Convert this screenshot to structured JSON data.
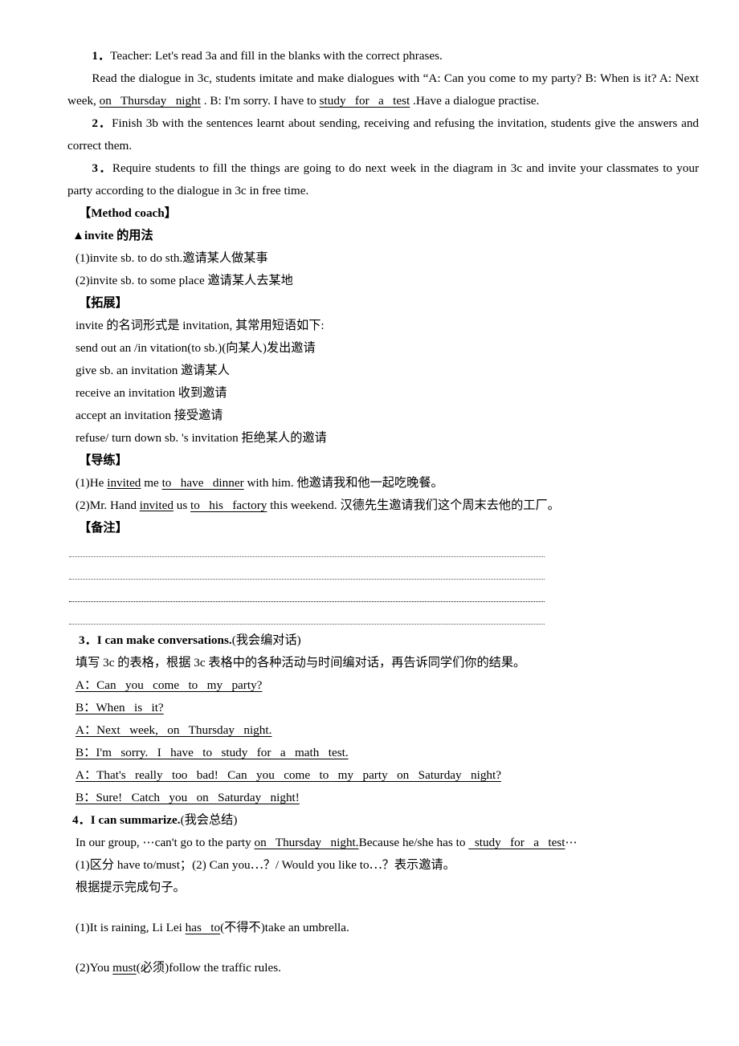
{
  "document": {
    "type": "lesson-plan-worksheet",
    "language": "en-zh"
  },
  "steps": [
    {
      "num": "1．",
      "text": "Teacher:  Let's read 3a and fill in the blanks with the correct phrases."
    },
    {
      "num": "",
      "text_pre": "Read the dialogue in 3c, students imitate and make dialogues with “A:  Can you come to my party? B: When is it? A: Next week, ",
      "blank1": "on   Thursday   night",
      "text_mid": " . B: I'm sorry. I have to ",
      "blank2": "study   for   a   test",
      "text_post": " .Have a dialogue practise."
    },
    {
      "num": "2．",
      "text": "Finish 3b with the sentences learnt about sending, receiving and refusing the invitation, students give the answers and correct them."
    },
    {
      "num": "3．",
      "text": "Require students to fill the things are going to do next week in the diagram in 3c and invite your classmates to your party according to the dialogue in 3c in free time."
    }
  ],
  "method_coach": {
    "heading": "【Method coach】",
    "subheading": "▲invite 的用法",
    "usages": [
      "(1)invite sb. to do sth.邀请某人做某事",
      "(2)invite sb. to some place 邀请某人去某地"
    ]
  },
  "expansion": {
    "heading": "【拓展】",
    "intro": "invite 的名词形式是 invitation, 其常用短语如下:",
    "phrases": [
      "send out an /in vitation(to sb.)(向某人)发出邀请",
      "give sb. an invitation 邀请某人",
      "receive an invitation 收到邀请",
      "accept an invitation 接受邀请",
      "refuse/ turn down sb. 's invitation 拒绝某人的邀请"
    ]
  },
  "guided_practice": {
    "heading": "【导练】",
    "items": [
      {
        "pre": "(1)He ",
        "u1": "invited",
        "mid1": " me ",
        "blank": "to   have   dinner",
        "post": " with him. 他邀请我和他一起吃晚餐。"
      },
      {
        "pre": "(2)Mr. Hand ",
        "u1": "invited",
        "mid1": " us ",
        "blank": "to   his   factory",
        "post": "  this weekend. 汉德先生邀请我们这个周末去他的工厂。"
      }
    ]
  },
  "notes": {
    "heading": "【备注】",
    "line_count": 4
  },
  "conversations": {
    "num": "3．",
    "title": "I can make conversations.",
    "title_cn": "(我会编对话)",
    "instruction": "填写 3c 的表格，根据 3c 表格中的各种活动与时间编对话，再告诉同学们你的结果。",
    "lines": [
      "A：Can   you   come   to   my   party?",
      "B：When   is   it?",
      "A：Next   week,   on   Thursday   night.",
      "B：I'm   sorry.   I   have   to   study   for   a   math   test.",
      "A：That's   really   too   bad!   Can   you   come   to   my   party   on   Saturday   night?",
      "B：Sure!   Catch   you   on   Saturday   night!"
    ]
  },
  "summarize": {
    "num": "4．",
    "title": "I can summarize.",
    "title_cn": "(我会总结)",
    "sentence_pre": "In our group, ⋯can't go to the party ",
    "sentence_blank1": "on   Thursday   night.",
    "sentence_mid": "Because he/she has to ",
    "sentence_blank2": "  study   for   a   test",
    "sentence_post": "⋯",
    "point_line": "(1)区分 have to/must；(2) Can you⋯？/ Would you like to⋯？表示邀请。",
    "prompt_line": "根据提示完成句子。",
    "exercises": [
      {
        "pre": "(1)It is raining, Li Lei ",
        "answer": "has   to",
        "hint": "(不得不)",
        "post": "take an umbrella."
      },
      {
        "pre": "(2)You ",
        "answer": "must",
        "hint": "(必须)",
        "post": "follow the traffic rules."
      }
    ]
  }
}
